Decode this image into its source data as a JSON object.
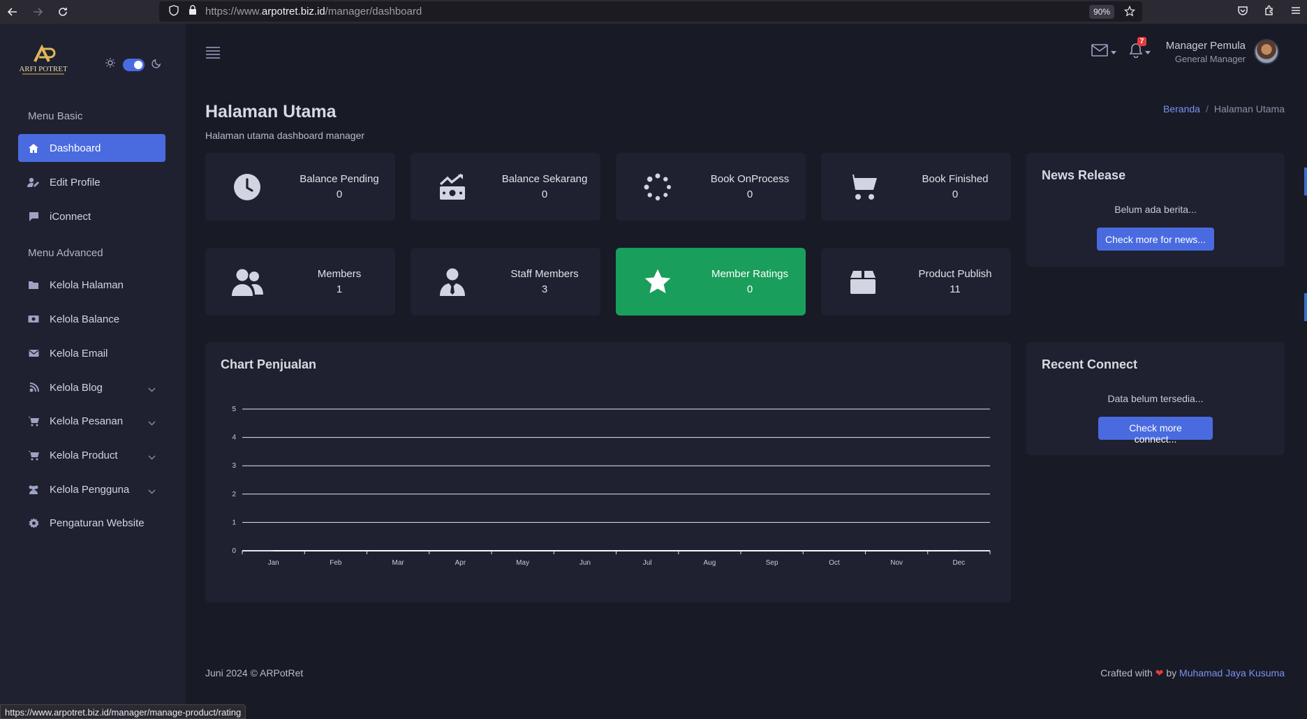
{
  "browser": {
    "url_prefix": "https://www.",
    "url_host": "arpotret.biz.id",
    "url_path": "/manager/dashboard",
    "zoom": "90%",
    "status_url": "https://www.arpotret.biz.id/manager/manage-product/rating"
  },
  "brand": {
    "logo_text": "ARFI POTRET"
  },
  "sidebar": {
    "basic_header": "Menu Basic",
    "advanced_header": "Menu Advanced",
    "basic_items": [
      {
        "label": "Dashboard",
        "icon": "home-icon",
        "active": true
      },
      {
        "label": "Edit Profile",
        "icon": "user-edit-icon"
      },
      {
        "label": "iConnect",
        "icon": "comment-icon"
      }
    ],
    "advanced_items": [
      {
        "label": "Kelola Halaman",
        "icon": "folder-icon"
      },
      {
        "label": "Kelola Balance",
        "icon": "money-icon"
      },
      {
        "label": "Kelola Email",
        "icon": "envelope-icon"
      },
      {
        "label": "Kelola Blog",
        "icon": "blog-icon",
        "has_submenu": true
      },
      {
        "label": "Kelola Pesanan",
        "icon": "cart-icon",
        "has_submenu": true
      },
      {
        "label": "Kelola Product",
        "icon": "cart-icon",
        "has_submenu": true
      },
      {
        "label": "Kelola Pengguna",
        "icon": "users-icon",
        "has_submenu": true
      },
      {
        "label": "Pengaturan Website",
        "icon": "gear-icon"
      }
    ]
  },
  "topbar": {
    "notification_count": "7",
    "user_name": "Manager Pemula",
    "user_role": "General Manager"
  },
  "page": {
    "title": "Halaman Utama",
    "subtitle": "Halaman utama dashboard manager",
    "breadcrumb_home": "Beranda",
    "breadcrumb_current": "Halaman Utama"
  },
  "stats": [
    {
      "label": "Balance Pending",
      "value": "0",
      "icon": "clock-icon"
    },
    {
      "label": "Balance Sekarang",
      "value": "0",
      "icon": "money-trend-icon"
    },
    {
      "label": "Book OnProcess",
      "value": "0",
      "icon": "spinner-icon"
    },
    {
      "label": "Book Finished",
      "value": "0",
      "icon": "cart-icon"
    },
    {
      "label": "Members",
      "value": "1",
      "icon": "users-icon"
    },
    {
      "label": "Staff Members",
      "value": "3",
      "icon": "user-tie-icon"
    },
    {
      "label": "Member Ratings",
      "value": "0",
      "icon": "star-icon",
      "highlight": "#1a9e5b"
    },
    {
      "label": "Product Publish",
      "value": "11",
      "icon": "box-icon"
    }
  ],
  "news": {
    "title": "News Release",
    "empty_text": "Belum ada berita...",
    "button": "Check more for news..."
  },
  "recent": {
    "title": "Recent Connect",
    "empty_text": "Data belum tersedia...",
    "button": "Check more connect..."
  },
  "chart_panel": {
    "title": "Chart Penjualan"
  },
  "chart_data": {
    "type": "line",
    "title": "Chart Penjualan",
    "categories": [
      "Jan",
      "Feb",
      "Mar",
      "Apr",
      "May",
      "Jun",
      "Jul",
      "Aug",
      "Sep",
      "Oct",
      "Nov",
      "Dec"
    ],
    "series": [
      {
        "values": [
          0,
          0,
          0,
          0,
          0,
          0,
          0,
          0,
          0,
          0,
          0,
          0
        ]
      }
    ],
    "ylim": [
      0,
      5
    ],
    "yticks": [
      "0",
      "1",
      "2",
      "3",
      "4",
      "5"
    ],
    "grid": true
  },
  "footer": {
    "left": "Juni 2024 © ARPotRet",
    "crafted": "Crafted with",
    "by": "by",
    "author": "Muhamad Jaya Kusuma"
  },
  "colors": {
    "accent": "#4a6be0",
    "success": "#1a9e5b",
    "danger": "#e53b3b",
    "background": "#181a26",
    "card": "#1f2130"
  }
}
